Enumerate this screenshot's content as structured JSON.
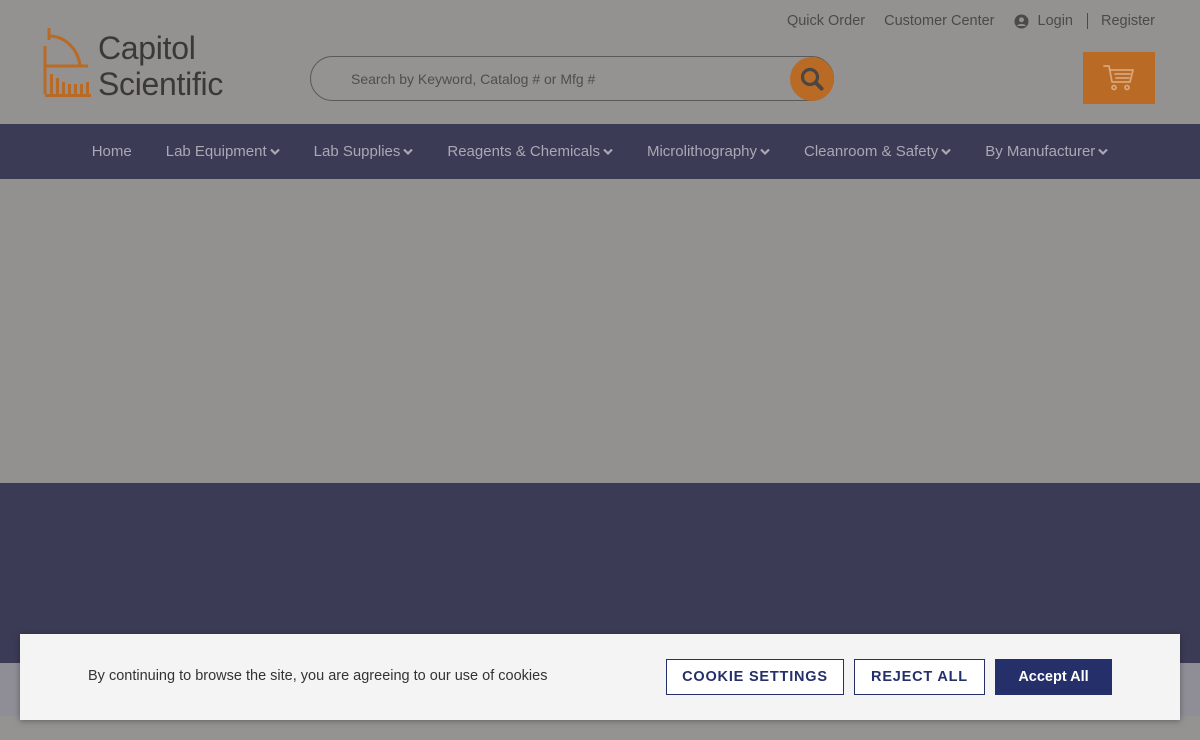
{
  "brand": {
    "line1": "Capitol",
    "line2": "Scientific"
  },
  "topnav": {
    "quick_order": "Quick Order",
    "customer_center": "Customer Center",
    "login": "Login",
    "register": "Register"
  },
  "search": {
    "placeholder": "Search by Keyword, Catalog # or Mfg #"
  },
  "mainnav": {
    "items": [
      {
        "label": "Home"
      },
      {
        "label": "Lab Equipment"
      },
      {
        "label": "Lab Supplies"
      },
      {
        "label": "Reagents & Chemicals"
      },
      {
        "label": "Microlithography"
      },
      {
        "label": "Cleanroom & Safety"
      },
      {
        "label": "By Manufacturer"
      }
    ]
  },
  "cookie": {
    "message": "By continuing to browse the site, you are agreeing to our use of cookies",
    "settings": "COOKIE SETTINGS",
    "reject": "REJECT ALL",
    "accept": "Accept All"
  },
  "colors": {
    "accent": "#b96a25",
    "nav_bg": "#3c3b56",
    "cookie_btn": "#25306a"
  }
}
